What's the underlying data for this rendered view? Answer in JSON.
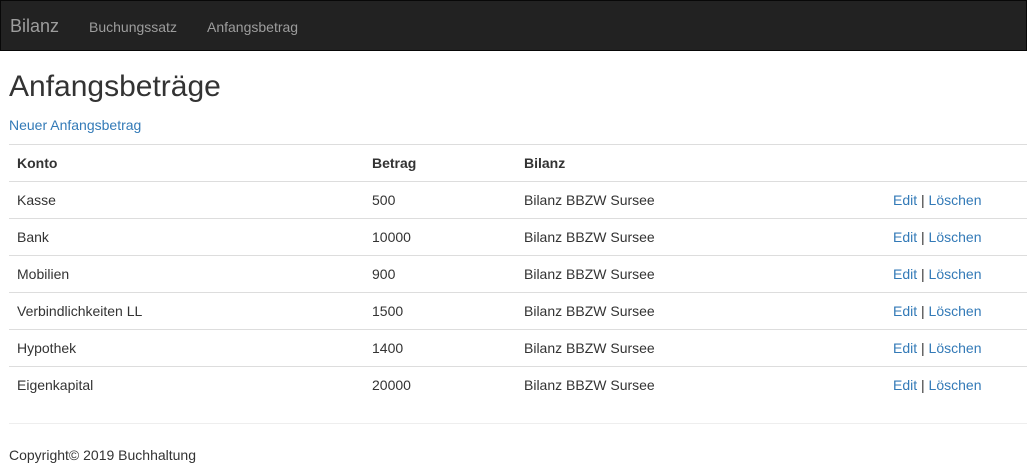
{
  "navbar": {
    "brand": "Bilanz",
    "links": [
      "Buchungssatz",
      "Anfangsbetrag"
    ]
  },
  "main": {
    "title": "Anfangsbeträge",
    "new_link": "Neuer Anfangsbetrag",
    "table": {
      "headers": [
        "Konto",
        "Betrag",
        "Bilanz",
        ""
      ],
      "rows": [
        {
          "konto": "Kasse",
          "betrag": "500",
          "bilanz": "Bilanz BBZW Sursee"
        },
        {
          "konto": "Bank",
          "betrag": "10000",
          "bilanz": "Bilanz BBZW Sursee"
        },
        {
          "konto": "Mobilien",
          "betrag": "900",
          "bilanz": "Bilanz BBZW Sursee"
        },
        {
          "konto": "Verbindlichkeiten LL",
          "betrag": "1500",
          "bilanz": "Bilanz BBZW Sursee"
        },
        {
          "konto": "Hypothek",
          "betrag": "1400",
          "bilanz": "Bilanz BBZW Sursee"
        },
        {
          "konto": "Eigenkapital",
          "betrag": "20000",
          "bilanz": "Bilanz BBZW Sursee"
        }
      ],
      "actions": {
        "edit": "Edit",
        "separator": "|",
        "delete": "Löschen"
      }
    }
  },
  "footer": {
    "text": "Copyright© 2019 Buchhaltung"
  },
  "colors": {
    "navbar_bg": "#222222",
    "navbar_text": "#9d9d9d",
    "link": "#337ab7",
    "text": "#333333",
    "border": "#dddddd"
  }
}
